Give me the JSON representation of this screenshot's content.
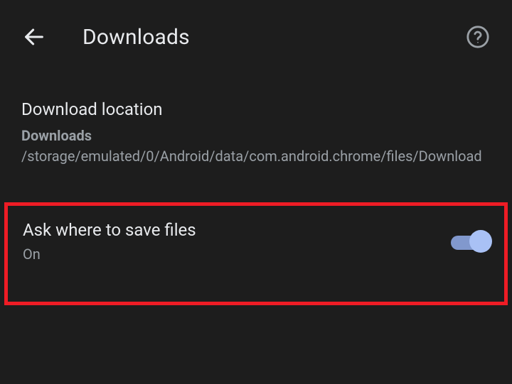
{
  "header": {
    "title": "Downloads"
  },
  "settings": {
    "downloadLocation": {
      "title": "Download location",
      "folderLabel": "Downloads ",
      "path": "/storage/emulated/0/Android/data/com.android.chrome/files/Download"
    },
    "askWhere": {
      "title": "Ask where to save files",
      "status": "On",
      "enabled": true
    }
  }
}
